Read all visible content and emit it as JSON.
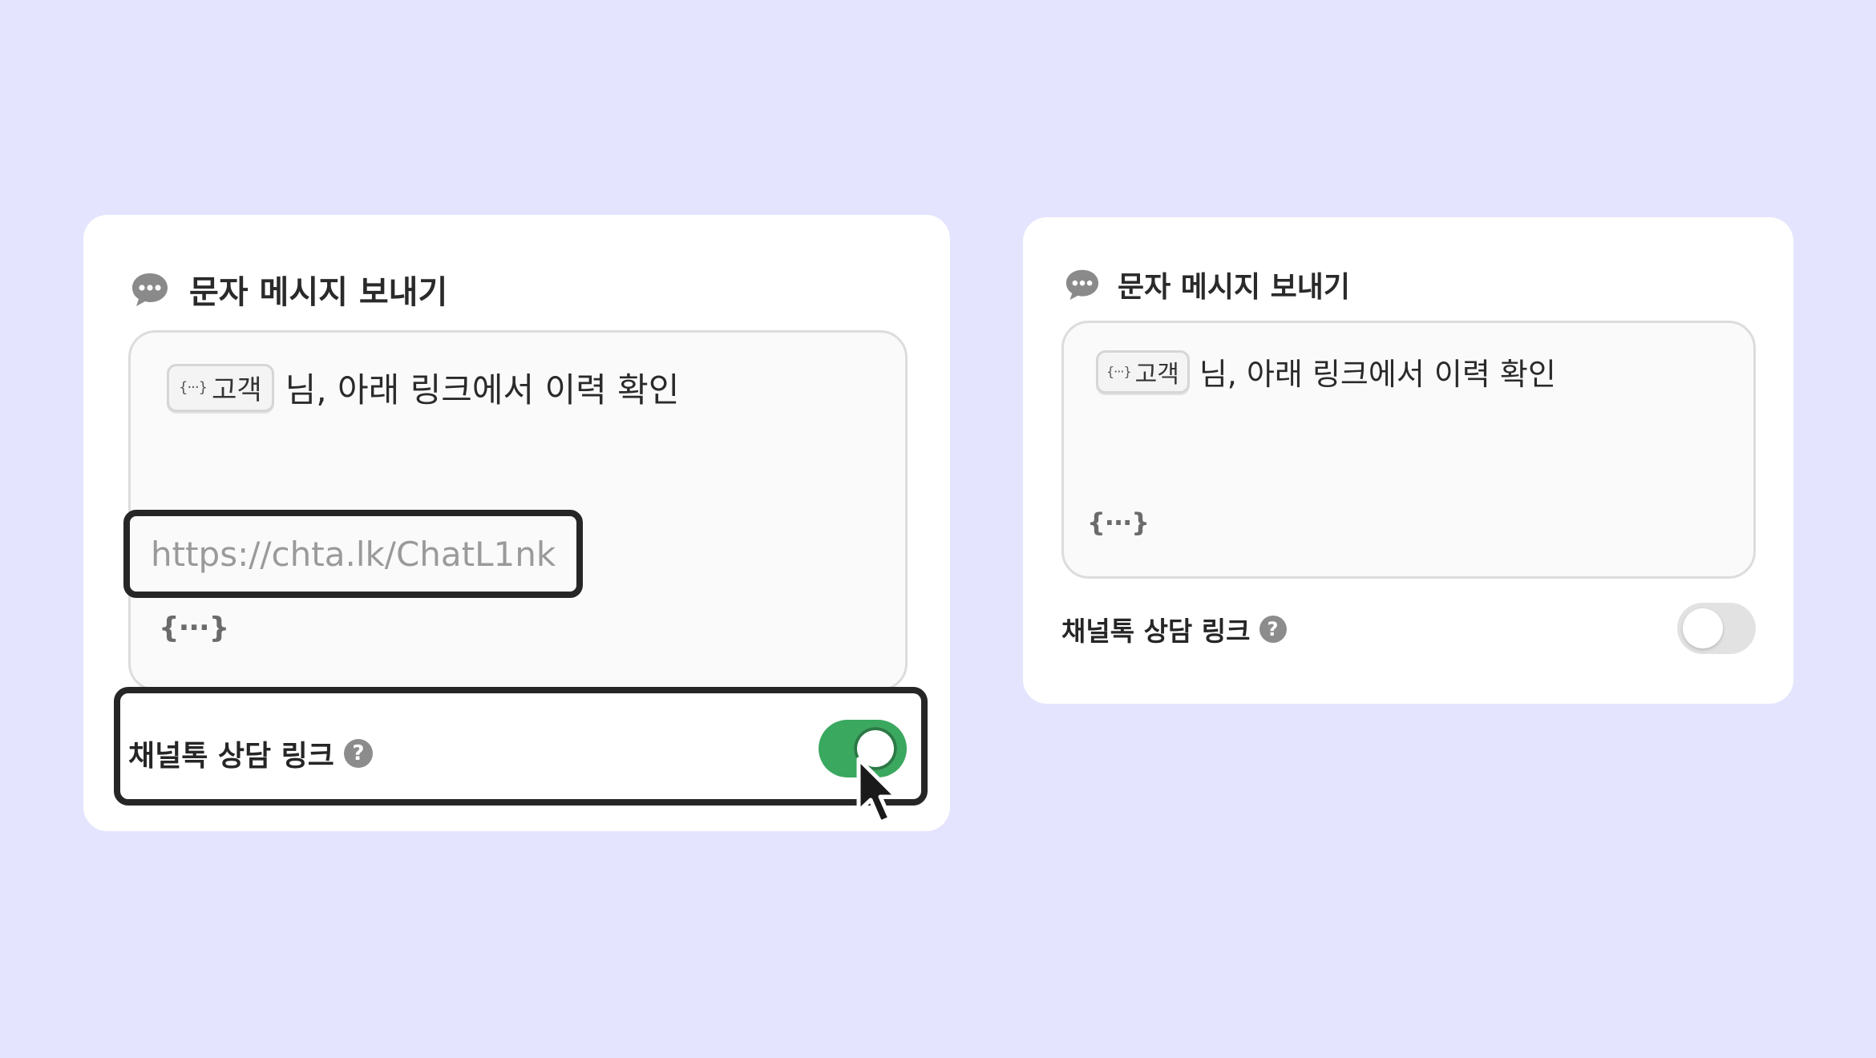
{
  "left_panel": {
    "title": "문자 메시지 보내기",
    "icon": "chat-bubble-icon",
    "message": {
      "variable_chip_label": "고객",
      "variable_chip_icon": "{···}",
      "text": "님, 아래 링크에서 이력 확인",
      "url": "https://chta.lk/ChatL1nk",
      "variable_insert": "{···}"
    },
    "setting": {
      "label": "채널톡 상담 링크",
      "help": "?",
      "toggle_on": true
    }
  },
  "right_panel": {
    "title": "문자 메시지 보내기",
    "icon": "chat-bubble-icon",
    "message": {
      "variable_chip_label": "고객",
      "variable_chip_icon": "{···}",
      "text": "님, 아래 링크에서 이력 확인",
      "variable_insert": "{···}"
    },
    "setting": {
      "label": "채널톡 상담 링크",
      "help": "?",
      "toggle_on": false
    }
  },
  "colors": {
    "background": "#e4e4fe",
    "toggle_on": "#3aa85f",
    "toggle_off": "#e2e2e2",
    "highlight_frame": "#262626"
  }
}
